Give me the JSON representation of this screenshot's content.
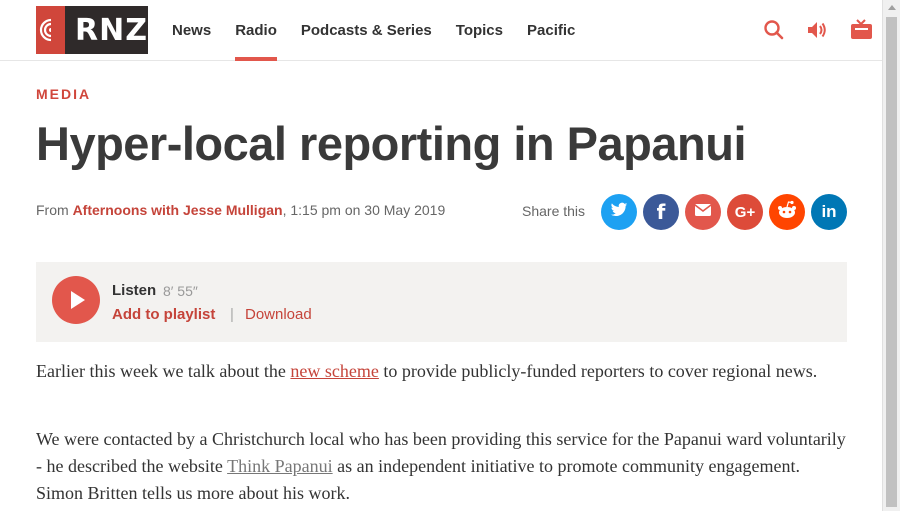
{
  "header": {
    "logo": "RNZ",
    "nav": [
      {
        "label": "News"
      },
      {
        "label": "Radio"
      },
      {
        "label": "Podcasts & Series"
      },
      {
        "label": "Topics"
      },
      {
        "label": "Pacific"
      }
    ],
    "active_nav": "Radio",
    "icons": [
      "search-icon",
      "speaker-icon",
      "tv-icon"
    ]
  },
  "article": {
    "category": "MEDIA",
    "title": "Hyper-local reporting in Papanui",
    "byline_prefix": "From",
    "show": "Afternoons with Jesse Mulligan",
    "time": ", 1:15 pm on 30 May 2019",
    "share_label": "Share this",
    "share": [
      {
        "name": "twitter",
        "glyph": "t",
        "color": "#1da1f2"
      },
      {
        "name": "facebook",
        "glyph": "f",
        "color": "#3b5998"
      },
      {
        "name": "email",
        "glyph": "✉",
        "color": "#e2574c"
      },
      {
        "name": "google-plus",
        "glyph": "G+",
        "color": "#dd4b39"
      },
      {
        "name": "reddit",
        "glyph": "◕",
        "color": "#ff4500"
      },
      {
        "name": "linkedin",
        "glyph": "in",
        "color": "#0077b5"
      }
    ]
  },
  "audio": {
    "listen_label": "Listen",
    "duration": "8′ 55″",
    "add_to_playlist": "Add to playlist",
    "separator": "|",
    "download": "Download"
  },
  "body": {
    "p1_a": "Earlier this week we talk about the ",
    "p1_link": "new scheme",
    "p1_b": " to provide publicly-funded reporters to cover regional news.",
    "p2_a": "We were contacted by a Christchurch local who has been providing this service for the Papanui ward voluntarily - he described the website ",
    "p2_link": "Think Papanui",
    "p2_b": " as an independent initiative to promote community engagement. Simon Britten tells us more about his work."
  },
  "colors": {
    "accent": "#e2574c",
    "link": "#c5443a",
    "logo_bg": "#2f2a2a"
  }
}
